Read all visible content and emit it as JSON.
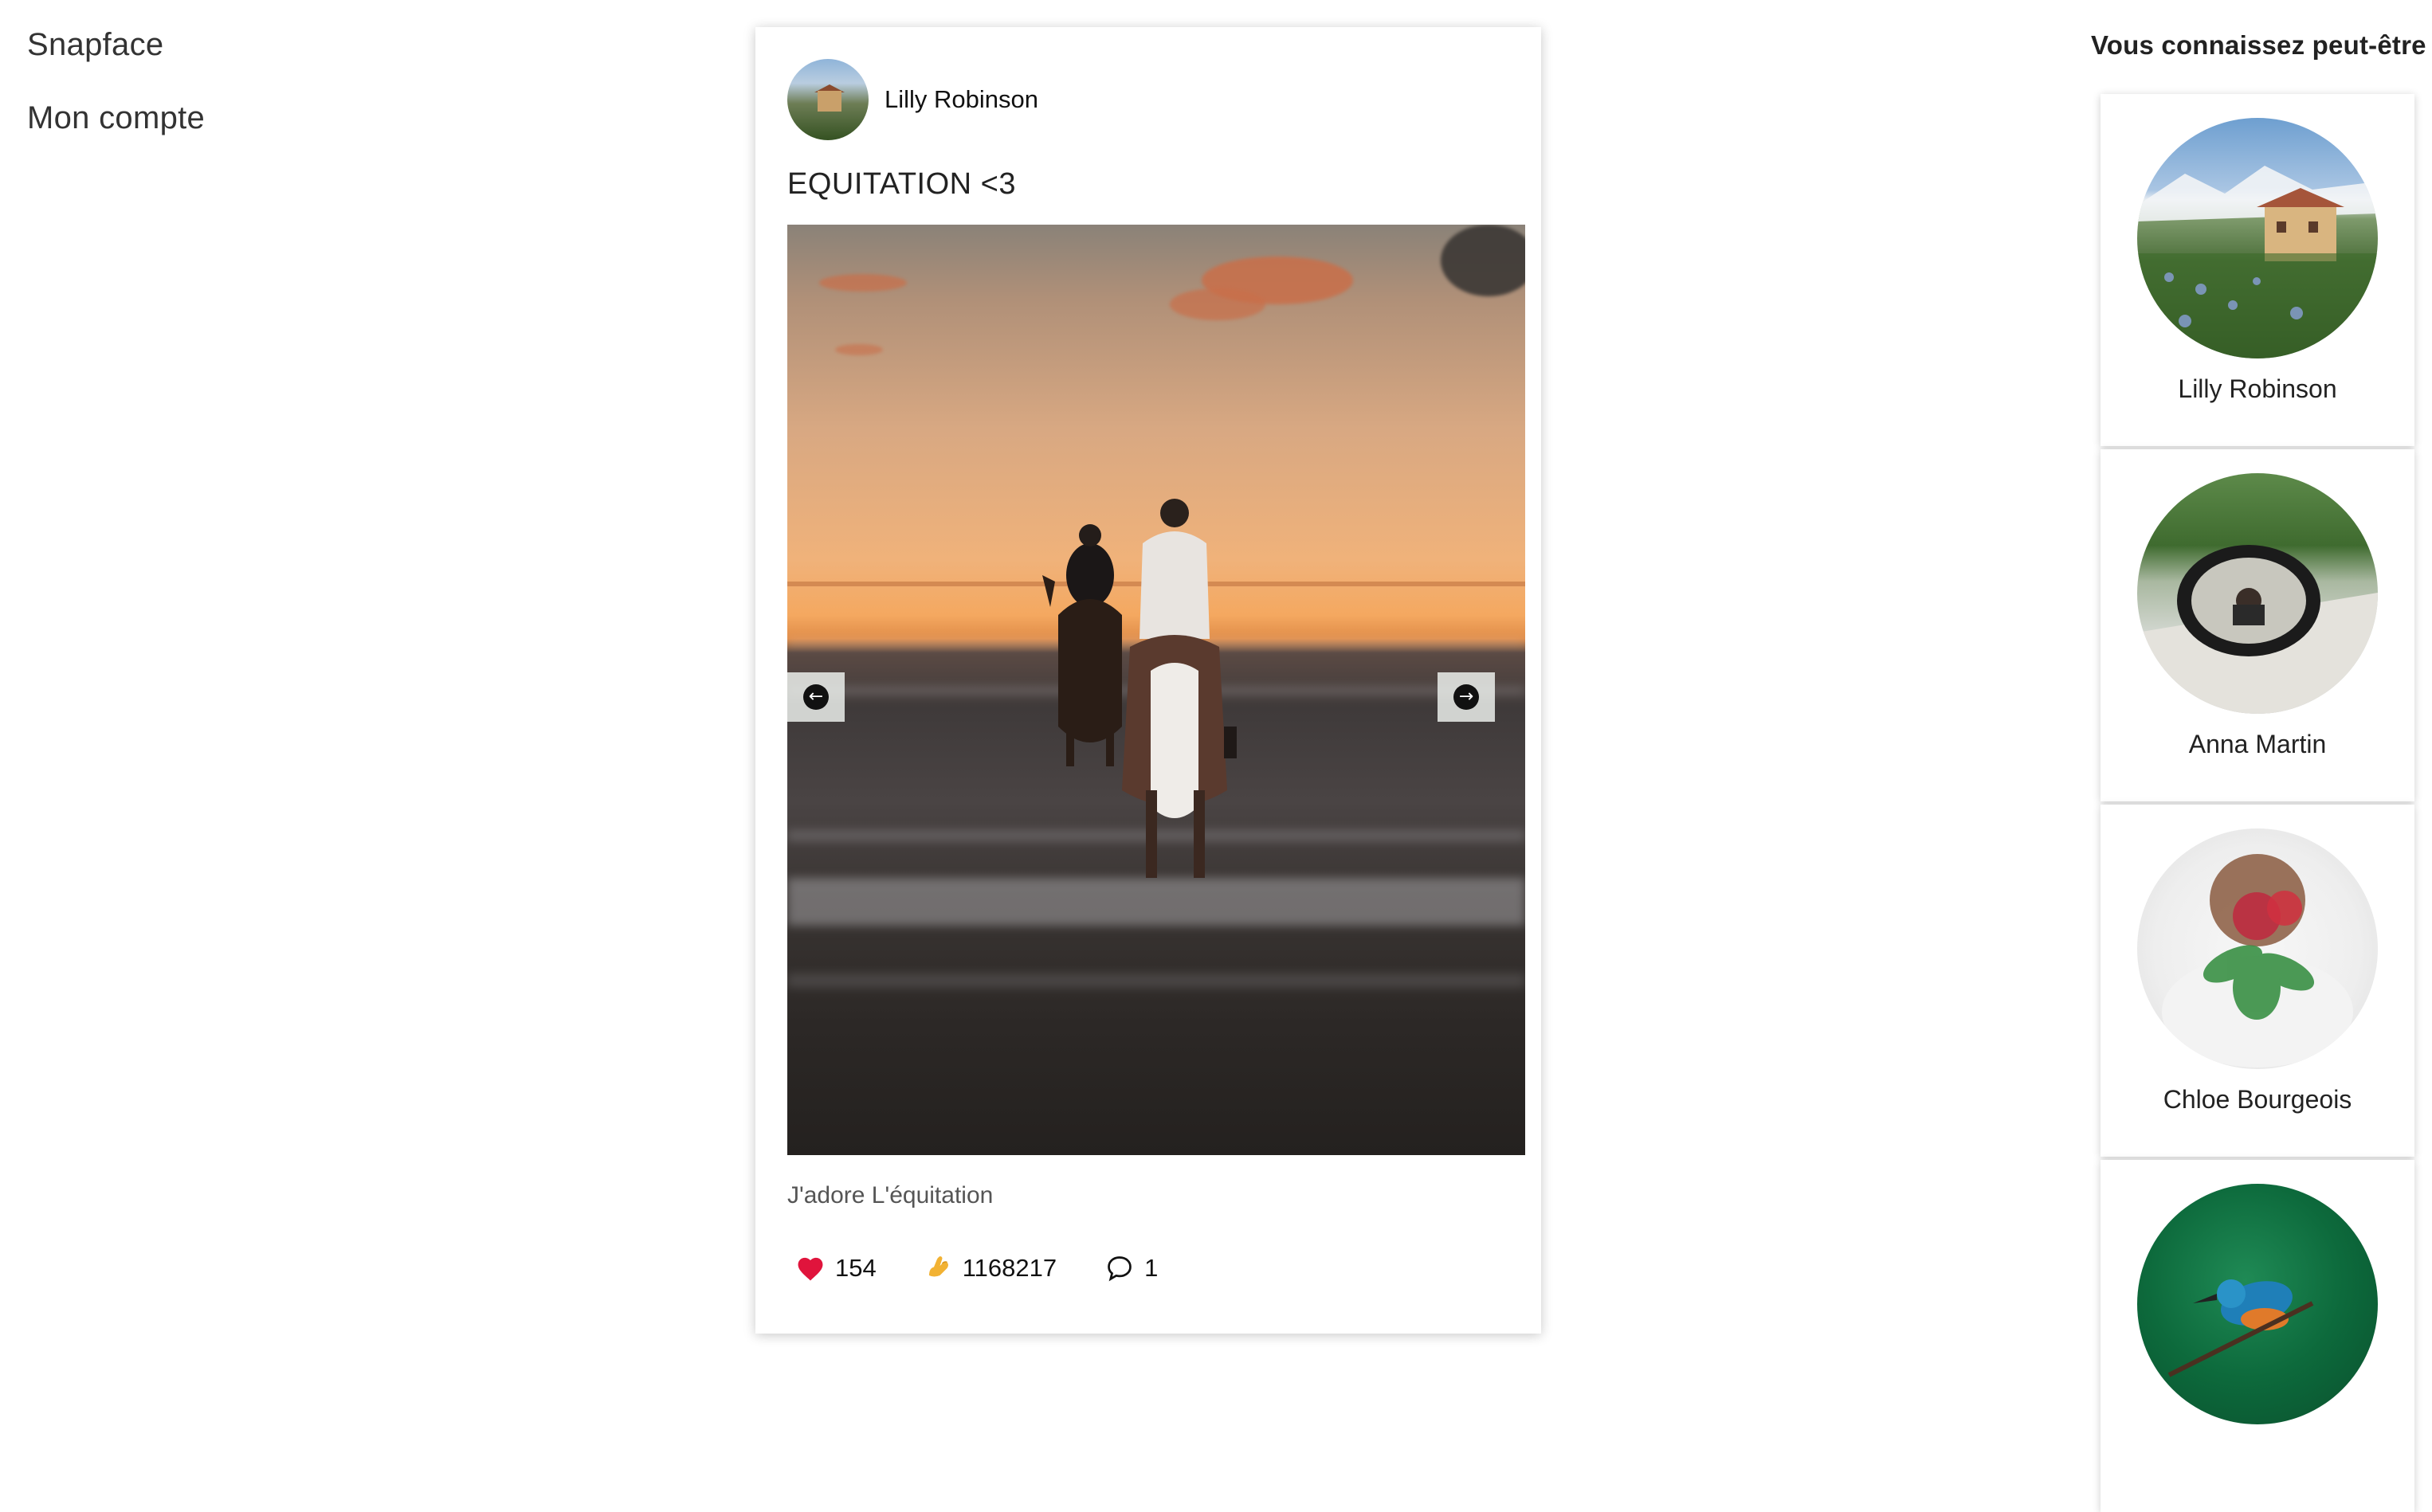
{
  "nav": {
    "brand": "Snapface",
    "account": "Mon compte"
  },
  "post": {
    "author": "Lilly Robinson",
    "title": "EQUITATION <3",
    "image_alt": "Two riders on horses in the sea at sunset",
    "caption": "J'adore L'équitation",
    "likes": "154",
    "snaps": "1168217",
    "comments": "1",
    "colors": {
      "heart": "#e0143c",
      "snap": "#f2b233"
    }
  },
  "suggestions": {
    "title": "Vous connaissez peut-être",
    "people": [
      {
        "name": "Lilly Robinson"
      },
      {
        "name": "Anna Martin"
      },
      {
        "name": "Chloe Bourgeois"
      },
      {
        "name": ""
      }
    ]
  }
}
